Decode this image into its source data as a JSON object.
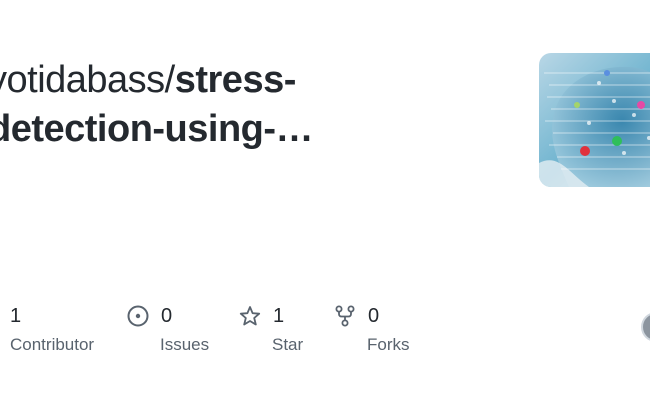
{
  "repo": {
    "owner_line": "yotidabass/",
    "name_line1": "stress-",
    "name_line2": "detection-using-…"
  },
  "stats": {
    "contributors": {
      "count": "1",
      "label": "Contributor",
      "icon": "people-icon"
    },
    "issues": {
      "count": "0",
      "label": "Issues",
      "icon": "issue-circle-icon"
    },
    "stars": {
      "count": "1",
      "label": "Star",
      "icon": "star-icon"
    },
    "forks": {
      "count": "0",
      "label": "Forks",
      "icon": "fork-icon"
    }
  },
  "colors": {
    "text": "#24292f",
    "muted": "#59636e",
    "icon": "#59636e"
  }
}
